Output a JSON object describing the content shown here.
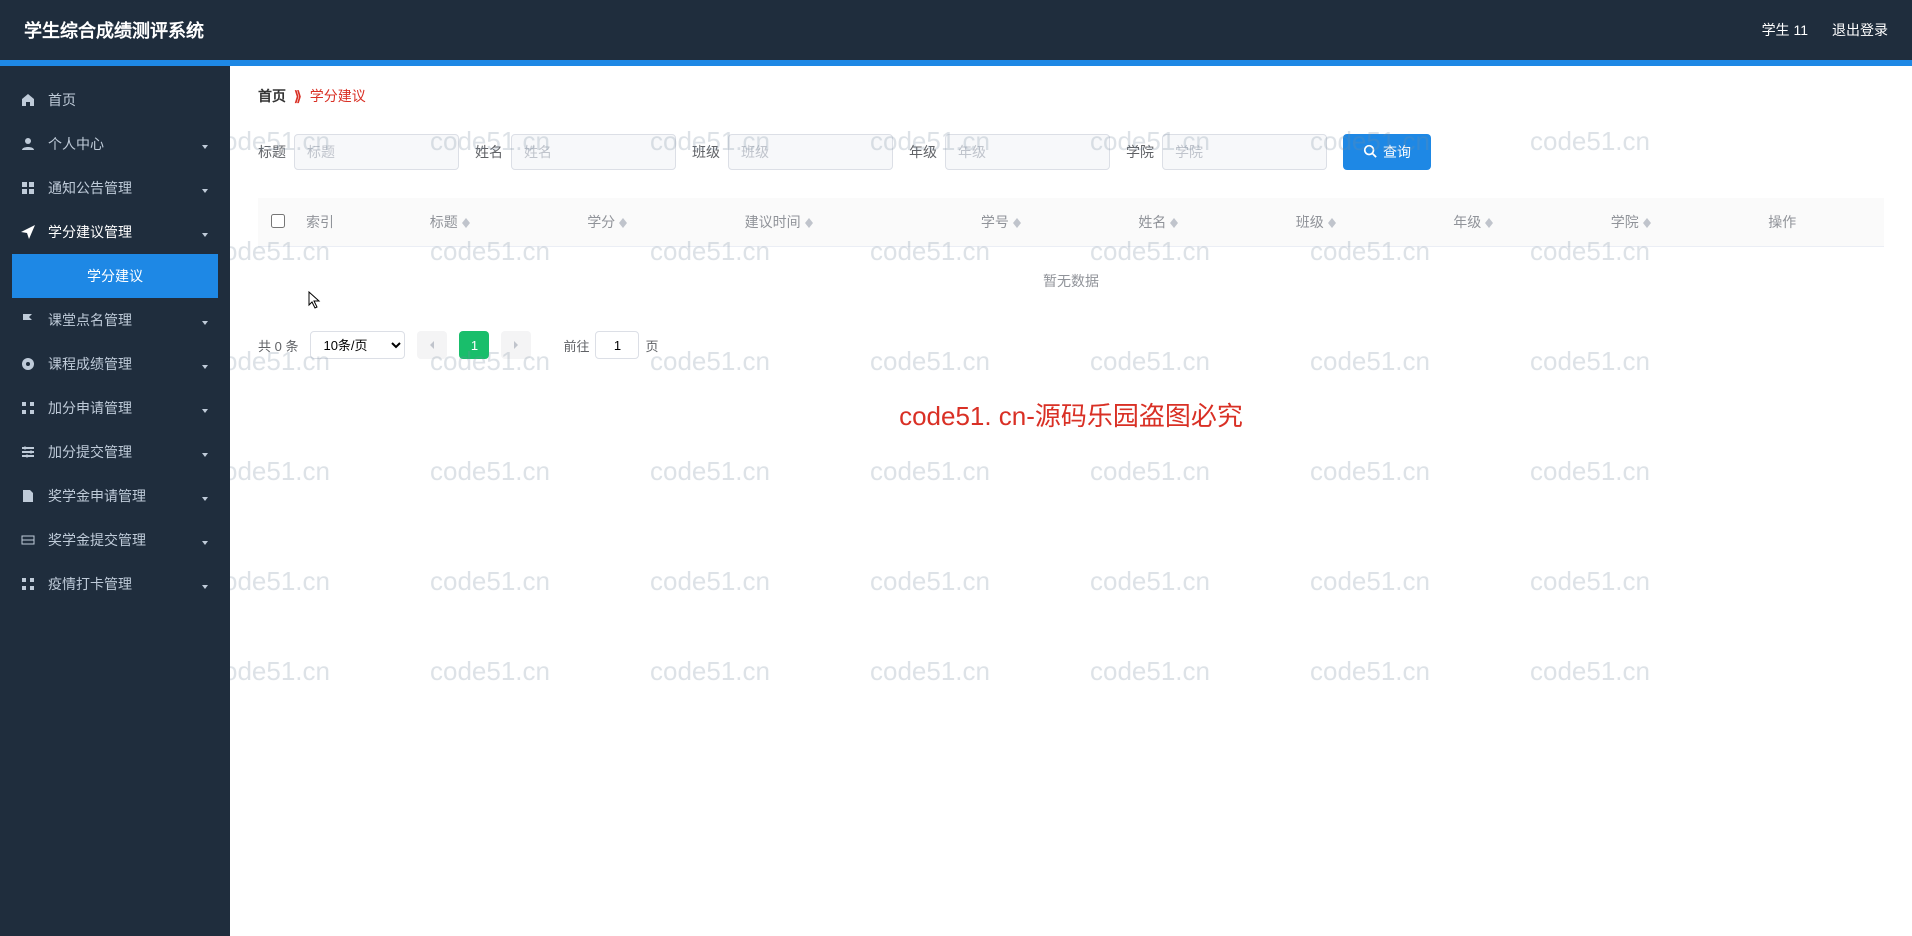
{
  "header": {
    "title": "学生综合成绩测评系统",
    "user": "学生 11",
    "logout": "退出登录"
  },
  "sidebar": {
    "items": [
      {
        "label": "首页",
        "icon": "home",
        "expandable": false
      },
      {
        "label": "个人中心",
        "icon": "user",
        "expandable": true
      },
      {
        "label": "通知公告管理",
        "icon": "grid",
        "expandable": true
      },
      {
        "label": "学分建议管理",
        "icon": "send",
        "expandable": true,
        "active": true,
        "sub": [
          {
            "label": "学分建议",
            "active": true
          }
        ]
      },
      {
        "label": "课堂点名管理",
        "icon": "flag",
        "expandable": true
      },
      {
        "label": "课程成绩管理",
        "icon": "record",
        "expandable": true
      },
      {
        "label": "加分申请管理",
        "icon": "grid2",
        "expandable": true
      },
      {
        "label": "加分提交管理",
        "icon": "sliders",
        "expandable": true
      },
      {
        "label": "奖学金申请管理",
        "icon": "doc",
        "expandable": true
      },
      {
        "label": "奖学金提交管理",
        "icon": "ticket",
        "expandable": true
      },
      {
        "label": "疫情打卡管理",
        "icon": "grid2",
        "expandable": true
      }
    ]
  },
  "breadcrumb": {
    "home": "首页",
    "current": "学分建议"
  },
  "filters": [
    {
      "label": "标题",
      "placeholder": "标题",
      "key": "title"
    },
    {
      "label": "姓名",
      "placeholder": "姓名",
      "key": "name"
    },
    {
      "label": "班级",
      "placeholder": "班级",
      "key": "class"
    },
    {
      "label": "年级",
      "placeholder": "年级",
      "key": "grade"
    },
    {
      "label": "学院",
      "placeholder": "学院",
      "key": "college"
    }
  ],
  "query_button": "查询",
  "table": {
    "columns": [
      "索引",
      "标题",
      "学分",
      "建议时间",
      "学号",
      "姓名",
      "班级",
      "年级",
      "学院",
      "操作"
    ],
    "empty_text": "暂无数据"
  },
  "pagination": {
    "total_text": "共 0 条",
    "per_page": "10条/页",
    "current": "1",
    "goto_prefix": "前往",
    "goto_value": "1",
    "goto_suffix": "页"
  },
  "watermark": {
    "main": "code51. cn-源码乐园盗图必究",
    "tile": "code51.cn"
  }
}
